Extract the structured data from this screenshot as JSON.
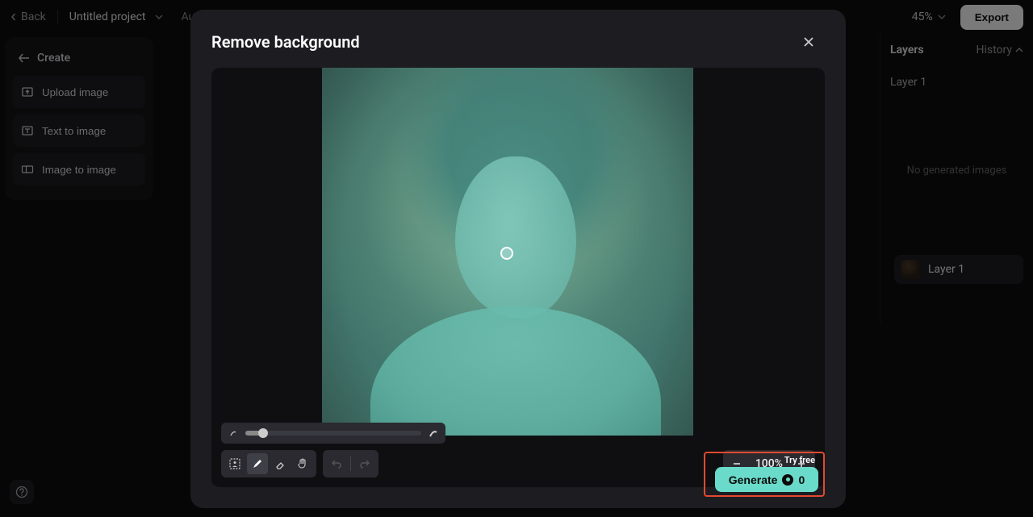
{
  "topbar": {
    "back": "Back",
    "title": "Untitled project",
    "autosave": "Autosave",
    "zoom": "45%",
    "export": "Export"
  },
  "sidebar": {
    "create": "Create",
    "upload": "Upload image",
    "text2img": "Text to image",
    "img2img": "Image to image"
  },
  "layers": {
    "title": "Layers",
    "history": "History",
    "layer1": "Layer 1",
    "empty": "No generated images",
    "thumb_label": "Layer 1"
  },
  "modal": {
    "title": "Remove background",
    "zoom": "100%",
    "try_free": "Try free",
    "generate": "Generate",
    "cost": "0"
  }
}
